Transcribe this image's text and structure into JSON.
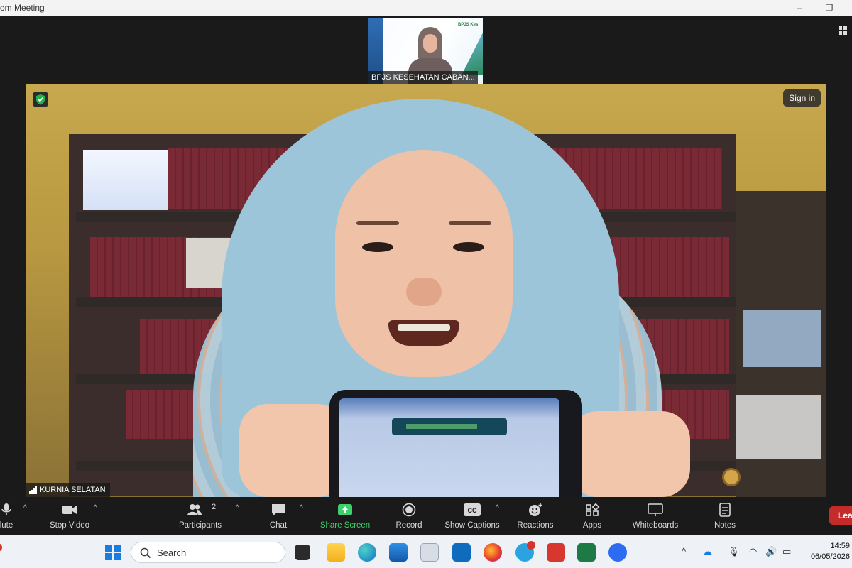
{
  "window": {
    "title": "om Meeting"
  },
  "thumbnail": {
    "label": "BPJS KESEHATAN CABAN...",
    "logo_text": "BPJS Kes"
  },
  "main_video": {
    "participant_name": "KURNIA SELATAN",
    "signin_label": "Sign in"
  },
  "toolbar": {
    "mute": "lute",
    "stop_video": "Stop Video",
    "participants": "Participants",
    "participants_count": "2",
    "chat": "Chat",
    "share_screen": "Share Screen",
    "record": "Record",
    "show_captions": "Show Captions",
    "captions_icon_text": "CC",
    "reactions": "Reactions",
    "apps": "Apps",
    "whiteboards": "Whiteboards",
    "notes": "Notes",
    "leave": "Lea"
  },
  "taskbar": {
    "search_text": "Search",
    "time": "14:59",
    "date": "06/05/2026",
    "apps": [
      "start-icon",
      "search-icon",
      "file-explorer-icon",
      "edge-icon",
      "store-icon",
      "outlook-icon",
      "firefox-icon",
      "telegram-icon",
      "acrobat-icon",
      "excel-icon",
      "zoom-icon"
    ]
  },
  "colors": {
    "toolbar_bg": "#1a1a1a",
    "share_green": "#3fcf6e",
    "leave_red": "#c42b2b",
    "taskbar_bg": "#eef1f6"
  }
}
